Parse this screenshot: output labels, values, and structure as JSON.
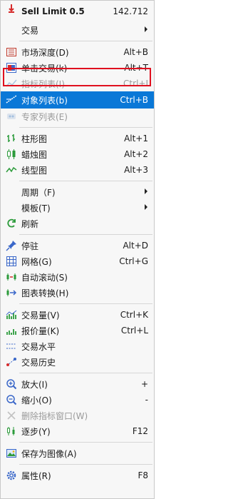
{
  "header": {
    "label": "Sell Limit 0.5",
    "value": "142.712"
  },
  "items": [
    {
      "label": "交易",
      "shortcut": "",
      "submenu": true
    },
    {
      "label": "市场深度(D)",
      "shortcut": "Alt+B"
    },
    {
      "label": "单击交易(k)",
      "shortcut": "Alt+T"
    },
    {
      "label": "指标列表(I)",
      "shortcut": "Ctrl+I",
      "disabled": true
    },
    {
      "label": "对象列表(b)",
      "shortcut": "Ctrl+B",
      "highlighted": true
    },
    {
      "label": "专家列表(E)",
      "shortcut": "",
      "disabled": true
    },
    {
      "label": "柱形图",
      "shortcut": "Alt+1"
    },
    {
      "label": "蜡烛图",
      "shortcut": "Alt+2"
    },
    {
      "label": "线型图",
      "shortcut": "Alt+3"
    },
    {
      "label": "周期（F)",
      "shortcut": "",
      "submenu": true
    },
    {
      "label": "模板(T)",
      "shortcut": "",
      "submenu": true
    },
    {
      "label": "刷新",
      "shortcut": ""
    },
    {
      "label": "停驻",
      "shortcut": "Alt+D"
    },
    {
      "label": "网格(G)",
      "shortcut": "Ctrl+G"
    },
    {
      "label": "自动滚动(S)",
      "shortcut": ""
    },
    {
      "label": "图表转换(H)",
      "shortcut": ""
    },
    {
      "label": "交易量(V)",
      "shortcut": "Ctrl+K"
    },
    {
      "label": "报价量(K)",
      "shortcut": "Ctrl+L"
    },
    {
      "label": "交易水平",
      "shortcut": ""
    },
    {
      "label": "交易历史",
      "shortcut": ""
    },
    {
      "label": "放大(I)",
      "shortcut": "+"
    },
    {
      "label": "缩小(O)",
      "shortcut": "-"
    },
    {
      "label": "删除指标窗口(W)",
      "shortcut": "",
      "disabled": true
    },
    {
      "label": "逐步(Y)",
      "shortcut": "F12"
    },
    {
      "label": "保存为图像(A)",
      "shortcut": ""
    },
    {
      "label": "属性(R)",
      "shortcut": "F8"
    }
  ],
  "colors": {
    "highlight": "#0a78d7",
    "outline": "#e0101f"
  }
}
